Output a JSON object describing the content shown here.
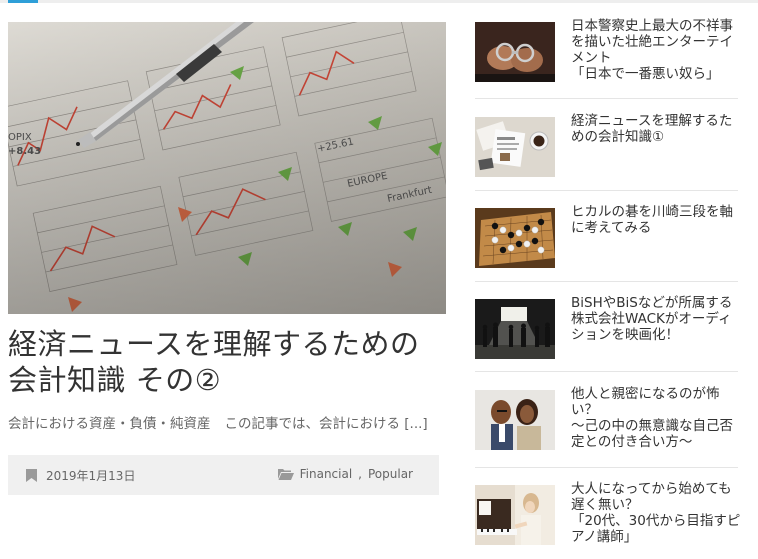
{
  "main_post": {
    "image_icon": "financial-newspaper-with-pen-image",
    "title": "経済ニュースを理解するための会計知識 その②",
    "excerpt_lead": "会計における資産・負債・純資産",
    "excerpt_body": "この記事では、会計における [...]",
    "date_icon": "bookmark-icon",
    "date": "2019年1月13日",
    "category_icon": "folders-icon",
    "categories": [
      "Financial",
      "Popular"
    ],
    "category_separator": ", "
  },
  "sidebar": {
    "items": [
      {
        "title": "日本警察史上最大の不祥事を描いた壮絶エンターテイメント\n「日本で一番悪い奴ら」",
        "thumb": "handcuffs-image"
      },
      {
        "title": "経済ニュースを理解するための会計知識①",
        "thumb": "coffee-and-papers-image"
      },
      {
        "title": "ヒカルの碁を川崎三段を軸に考えてみる",
        "thumb": "go-board-image"
      },
      {
        "title": "BiSHやBiSなどが所属する株式会社WACKがオーディションを映画化！",
        "thumb": "stage-audition-image"
      },
      {
        "title": "他人と親密になるのが怖い？\n〜己の中の無意識な自己否定との付き合い方〜",
        "thumb": "couple-image"
      },
      {
        "title": "大人になってから始めても遅く無い？\n「20代、30代から目指すピアノ講師」",
        "thumb": "piano-player-image"
      }
    ]
  },
  "colors": {
    "accent": "#2e9fd8",
    "meta_bg": "#f0f0f0",
    "divider": "#e5e5e5"
  }
}
